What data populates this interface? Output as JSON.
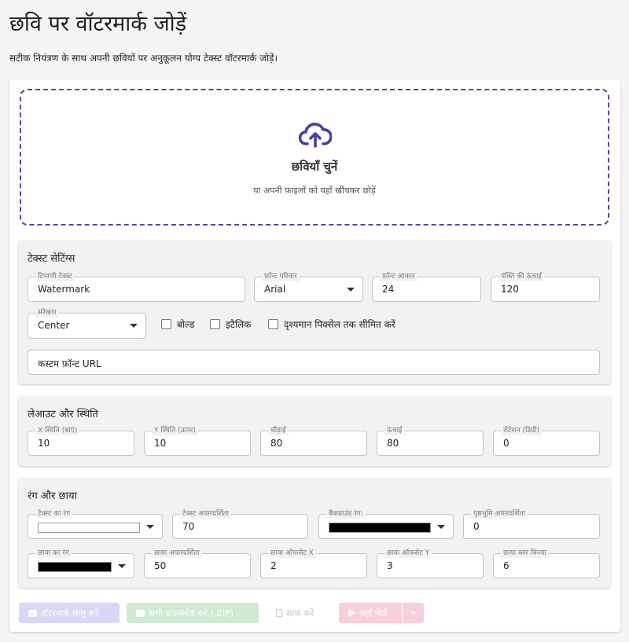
{
  "header": {
    "title": "छवि पर वॉटरमार्क जोड़ें",
    "subtitle": "सटीक नियंत्रण के साथ अपनी छवियों पर अनुकूलन योग्य टेक्स्ट वॉटरमार्क जोड़ें।"
  },
  "dropzone": {
    "title": "छवियाँ चुनें",
    "hint": "या अपनी फ़ाइलों को यहाँ खींचकर छोड़ें"
  },
  "text_settings": {
    "title": "टेक्स्ट सेटिंग्स",
    "comment_text": {
      "label": "टिप्पणी टेक्स्ट",
      "value": "Watermark"
    },
    "font_family": {
      "label": "फ़ॉन्ट परिवार",
      "value": "Arial"
    },
    "font_size": {
      "label": "फ़ॉन्ट आकार",
      "value": "24"
    },
    "line_height": {
      "label": "पंक्ति की ऊंचाई",
      "value": "120"
    },
    "alignment": {
      "label": "संरेखण",
      "value": "Center"
    },
    "bold_label": "बोल्ड",
    "italic_label": "इटैलिक",
    "clip_label": "दृश्यमान पिक्सेल तक सीमित करें",
    "custom_font_placeholder": "कस्टम फ़ॉन्ट URL"
  },
  "layout": {
    "title": "लेआउट और स्थिति",
    "x": {
      "label": "X स्थिति (बाएं)",
      "value": "10"
    },
    "y": {
      "label": "Y स्थिति (ऊपर)",
      "value": "10"
    },
    "width": {
      "label": "चौड़ाई",
      "value": "80"
    },
    "height": {
      "label": "ऊंचाई",
      "value": "80"
    },
    "rotation": {
      "label": "रोटेशन (डिग्री)",
      "value": "0"
    }
  },
  "colors": {
    "title": "रंग और छाया",
    "text_color": {
      "label": "टेक्स्ट का रंग",
      "color": "#ffffff"
    },
    "text_opacity": {
      "label": "टेक्स्ट अपारदर्शिता",
      "value": "70"
    },
    "bg_color": {
      "label": "बैकग्राउंड रंग:",
      "color": "#000000"
    },
    "bg_opacity": {
      "label": "पृष्ठभूमि अपारदर्शिता",
      "value": "0"
    },
    "shadow_color": {
      "label": "छाया का रंग",
      "color": "#000000"
    },
    "shadow_opacity": {
      "label": "छाया अपारदर्शिता",
      "value": "50"
    },
    "shadow_offset_x": {
      "label": "छाया ऑफसेट X",
      "value": "2"
    },
    "shadow_offset_y": {
      "label": "छाया ऑफसेट Y",
      "value": "3"
    },
    "shadow_blur": {
      "label": "छाया ब्लर त्रिज्या",
      "value": "6"
    }
  },
  "actions": {
    "apply": "वॉटरमार्क लागू करें",
    "download_all": "सभी डाउनलोड करें (.ZIP)",
    "clear": "साफ़ करें",
    "send": "यहाँ भेजें"
  },
  "theme": {
    "accent": "#3f3fb5",
    "apply_bg": "#d6d8f5",
    "download_bg": "#cfe9d3",
    "send_bg": "#f9d0da"
  }
}
